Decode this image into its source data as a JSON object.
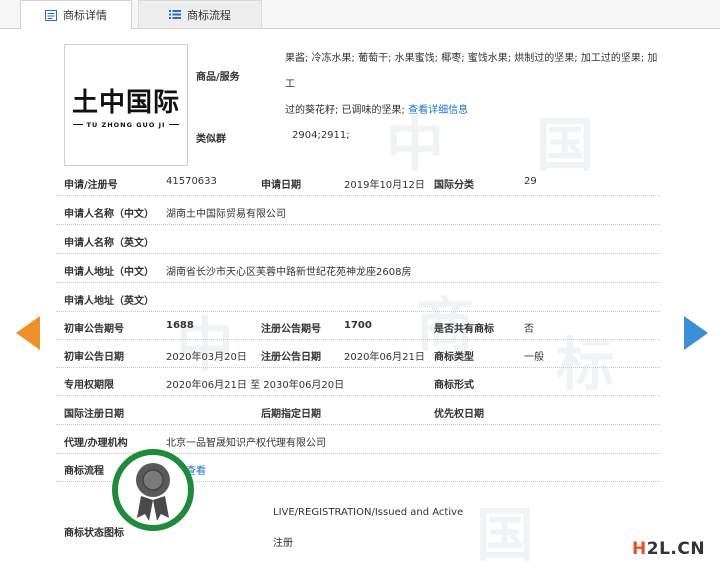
{
  "tabs": [
    {
      "label": "商标详情",
      "icon": "document-icon",
      "active": true
    },
    {
      "label": "商标流程",
      "icon": "list-icon",
      "active": false
    }
  ],
  "logo": {
    "text_cn": "土中国际",
    "text_en": "TU ZHONG GUO JI"
  },
  "goods": {
    "label": "商品/服务",
    "line1": "果酱; 冷冻水果; 葡萄干; 水果蜜饯; 椰枣; 蜜饯水果; 烘制过的坚果; 加工过的坚果; 加工",
    "line2": "过的葵花籽; 已调味的坚果;",
    "link": "查看详细信息"
  },
  "similar_group": {
    "label": "类似群",
    "value": "2904;2911;"
  },
  "fields": {
    "reg_no_label": "申请/注册号",
    "reg_no": "41570633",
    "apply_date_label": "申请日期",
    "apply_date": "2019年10月12日",
    "intl_class_label": "国际分类",
    "intl_class": "29",
    "applicant_cn_label": "申请人名称（中文）",
    "applicant_cn": "湖南土中国际贸易有限公司",
    "applicant_en_label": "申请人名称（英文）",
    "applicant_en": "",
    "address_cn_label": "申请人地址（中文）",
    "address_cn": "湖南省长沙市天心区芙蓉中路新世纪花苑神龙座2608房",
    "address_en_label": "申请人地址（英文）",
    "address_en": "",
    "prelim_no_label": "初审公告期号",
    "prelim_no": "1688",
    "reg_ann_no_label": "注册公告期号",
    "reg_ann_no": "1700",
    "shared_label": "是否共有商标",
    "shared": "否",
    "prelim_date_label": "初审公告日期",
    "prelim_date": "2020年03月20日",
    "reg_ann_date_label": "注册公告日期",
    "reg_ann_date": "2020年06月21日",
    "type_label": "商标类型",
    "type": "一般",
    "exclusive_label": "专用权期限",
    "exclusive": "2020年06月21日 至 2030年06月20日",
    "form_label": "商标形式",
    "form": "",
    "intl_reg_date_label": "国际注册日期",
    "intl_reg_date": "",
    "later_date_label": "后期指定日期",
    "later_date": "",
    "priority_label": "优先权日期",
    "priority": "",
    "agent_label": "代理/办理机构",
    "agent": "北京一品智晟知识产权代理有限公司",
    "process_label": "商标流程",
    "process_link": "点击查看",
    "status_label": "商标状态图标",
    "status_en": "LIVE/REGISTRATION/Issued and Active",
    "status_cn": "注册"
  },
  "site_badge": {
    "h": "H",
    "rest": "2L.CN"
  },
  "watermark_chars": [
    "中",
    "国",
    "商",
    "标"
  ],
  "colors": {
    "link": "#1a73c9",
    "arrow_left": "#f0902a",
    "arrow_right": "#3b8fd8",
    "seal_ring": "#1f8a3c"
  }
}
